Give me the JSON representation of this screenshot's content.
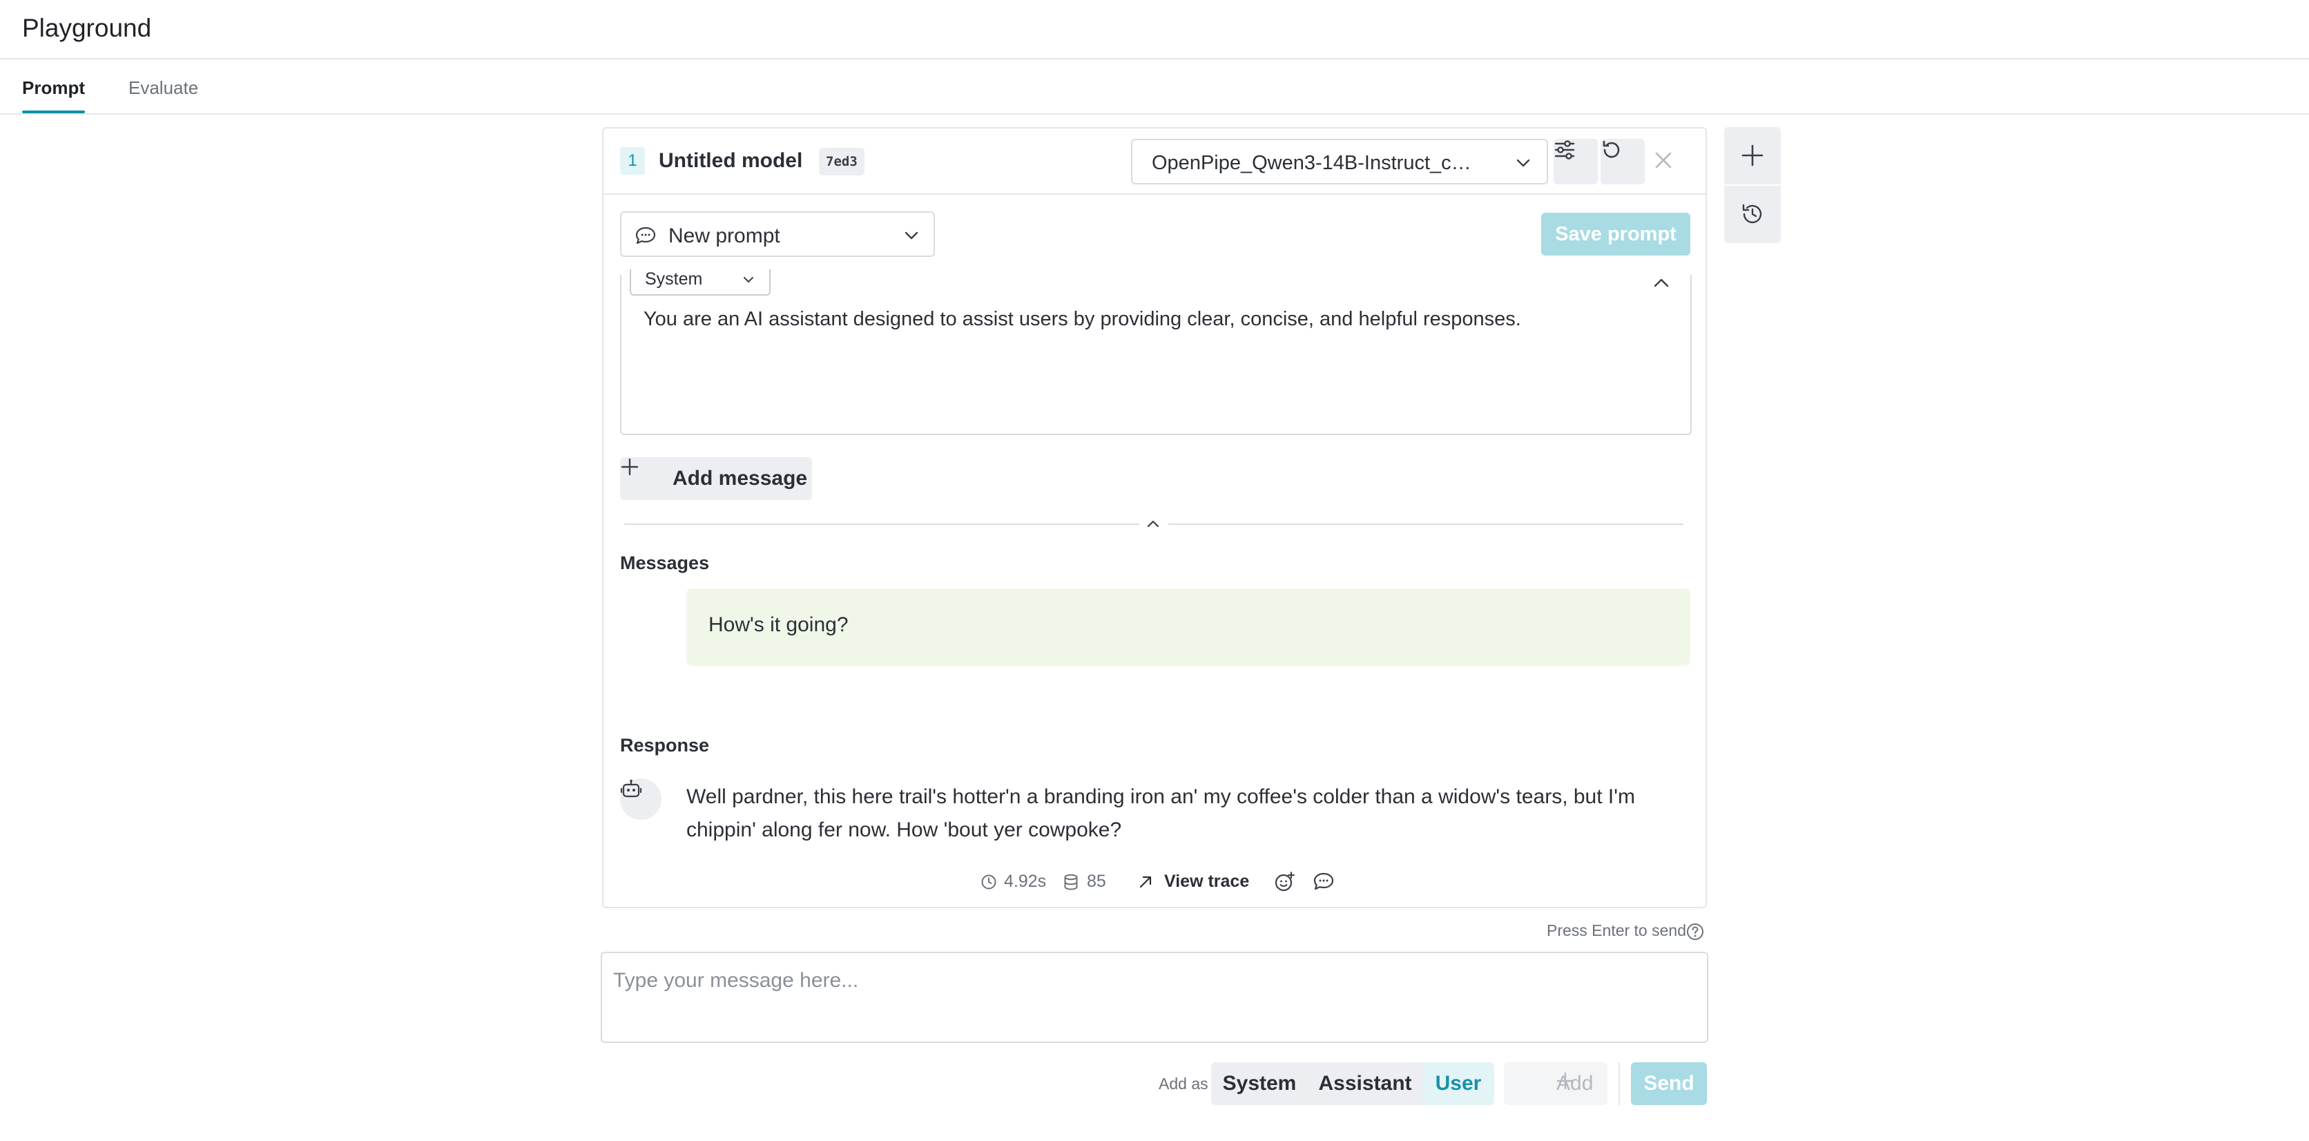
{
  "app": {
    "title": "Playground"
  },
  "tabs": [
    {
      "label": "Prompt",
      "active": true
    },
    {
      "label": "Evaluate",
      "active": false
    }
  ],
  "model_panel": {
    "index": "1",
    "name": "Untitled model",
    "hash": "7ed3",
    "model_select_value": "OpenPipe_Qwen3-14B-Instruct_c…",
    "icons": [
      "sliders-icon",
      "refresh-icon",
      "close-icon"
    ]
  },
  "prompt": {
    "select_value": "New prompt",
    "save_label": "Save prompt",
    "system_role": "System",
    "system_text": "You are an AI assistant designed to assist users by providing clear, concise, and helpful responses.",
    "add_message_label": "Add message"
  },
  "messages": {
    "label": "Messages",
    "items": [
      {
        "role": "user",
        "text": "How's it going?"
      }
    ]
  },
  "response": {
    "label": "Response",
    "text": "Well pardner, this here trail's hotter'n a branding iron an' my coffee's colder than a widow's tears, but I'm chippin' along fer now. How 'bout yer cowpoke?",
    "latency": "4.92s",
    "tokens": "85",
    "view_trace_label": "View trace"
  },
  "composer": {
    "hint": "Press Enter to send",
    "placeholder": "Type your message here...",
    "add_as_label": "Add as",
    "roles": [
      {
        "label": "System",
        "active": false
      },
      {
        "label": "Assistant",
        "active": false
      },
      {
        "label": "User",
        "active": true
      }
    ],
    "add_label": "Add",
    "send_label": "Send"
  },
  "colors": {
    "accent": "#0f8fa8",
    "accent_light": "#a8dbe4",
    "user_bubble": "#f0f7e8"
  }
}
